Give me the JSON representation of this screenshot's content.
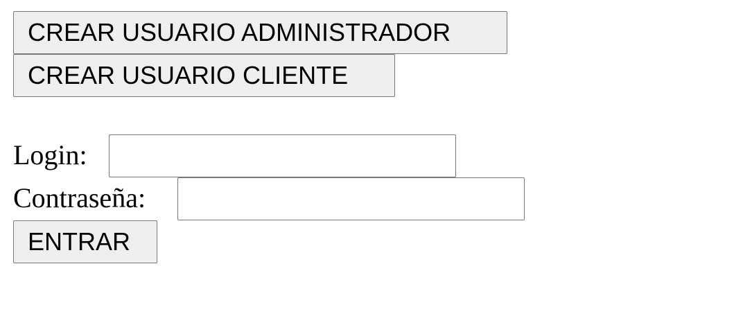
{
  "buttons": {
    "create_admin": "CREAR USUARIO ADMINISTRADOR",
    "create_client": "CREAR USUARIO CLIENTE",
    "enter": "ENTRAR"
  },
  "form": {
    "login_label": "Login:",
    "login_value": "",
    "password_label": "Contraseña:",
    "password_value": ""
  },
  "colors": {
    "button_bg": "#efefef",
    "border": "#767676",
    "text": "#000000",
    "background": "#ffffff"
  }
}
